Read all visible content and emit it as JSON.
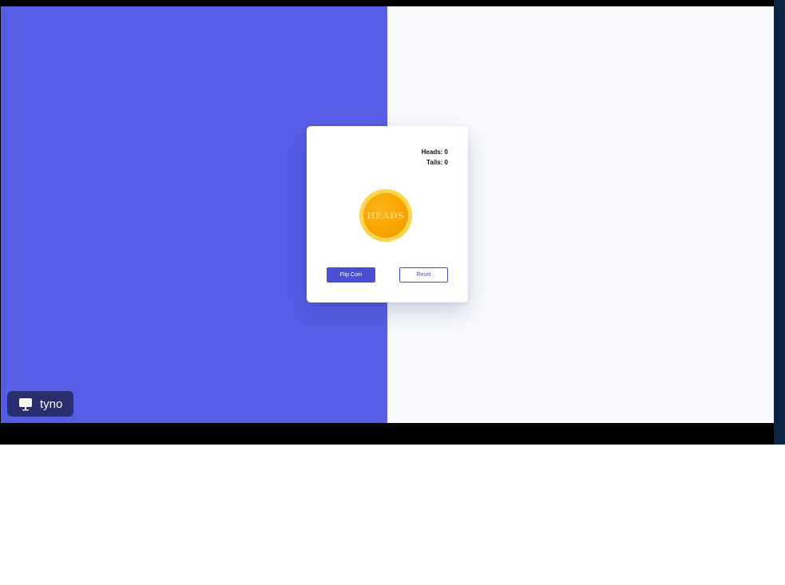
{
  "card": {
    "heads_label": "Heads: 0",
    "tails_label": "Tails: 0",
    "coin_face": "HEADS",
    "flip_button": "Flip Coin",
    "reset_button": "Reset"
  },
  "badge": {
    "label": "tyno",
    "icon": "monitor-icon"
  },
  "colors": {
    "left_background": "#565ee5",
    "right_background": "#f7f9fd",
    "accent": "#4a4fd8",
    "coin_rim": "#f8d64e",
    "coin_face": "#f8a300",
    "badge_background": "#2a2d6e"
  }
}
